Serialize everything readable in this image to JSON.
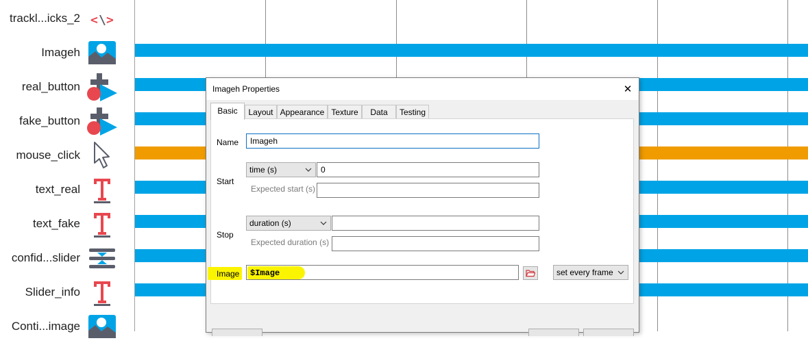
{
  "components": [
    {
      "label": "trackl...icks_2",
      "icon": "code-icon"
    },
    {
      "label": "Imageh",
      "icon": "image-icon"
    },
    {
      "label": "real_button",
      "icon": "button-shapes-icon"
    },
    {
      "label": "fake_button",
      "icon": "button-shapes-icon"
    },
    {
      "label": "mouse_click",
      "icon": "mouse-cursor-icon"
    },
    {
      "label": "text_real",
      "icon": "text-icon"
    },
    {
      "label": "text_fake",
      "icon": "text-icon"
    },
    {
      "label": "confid...slider",
      "icon": "slider-icon"
    },
    {
      "label": "Slider_info",
      "icon": "text-icon"
    },
    {
      "label": "Conti...image",
      "icon": "image-icon"
    }
  ],
  "colors": {
    "bar_blue": "#00a4e6",
    "bar_orange": "#f09c00",
    "highlight": "#fbf400",
    "icon_red": "#e8474f",
    "icon_grey": "#5a5e6b"
  },
  "dialog": {
    "title": "Imageh Properties",
    "close_glyph": "✕",
    "tabs": [
      "Basic",
      "Layout",
      "Appearance",
      "Texture",
      "Data",
      "Testing"
    ],
    "active_tab": "Basic",
    "fields": {
      "name_label": "Name",
      "name_value": "Imageh",
      "start_label": "Start",
      "start_type": "time (s)",
      "start_value": "0",
      "expected_start_label": "Expected start (s)",
      "expected_start_value": "",
      "stop_label": "Stop",
      "stop_type": "duration (s)",
      "stop_value": "",
      "expected_duration_label": "Expected duration (s)",
      "expected_duration_value": "",
      "image_label": "Image",
      "image_value": "$Image",
      "update_mode": "set every frame"
    }
  }
}
